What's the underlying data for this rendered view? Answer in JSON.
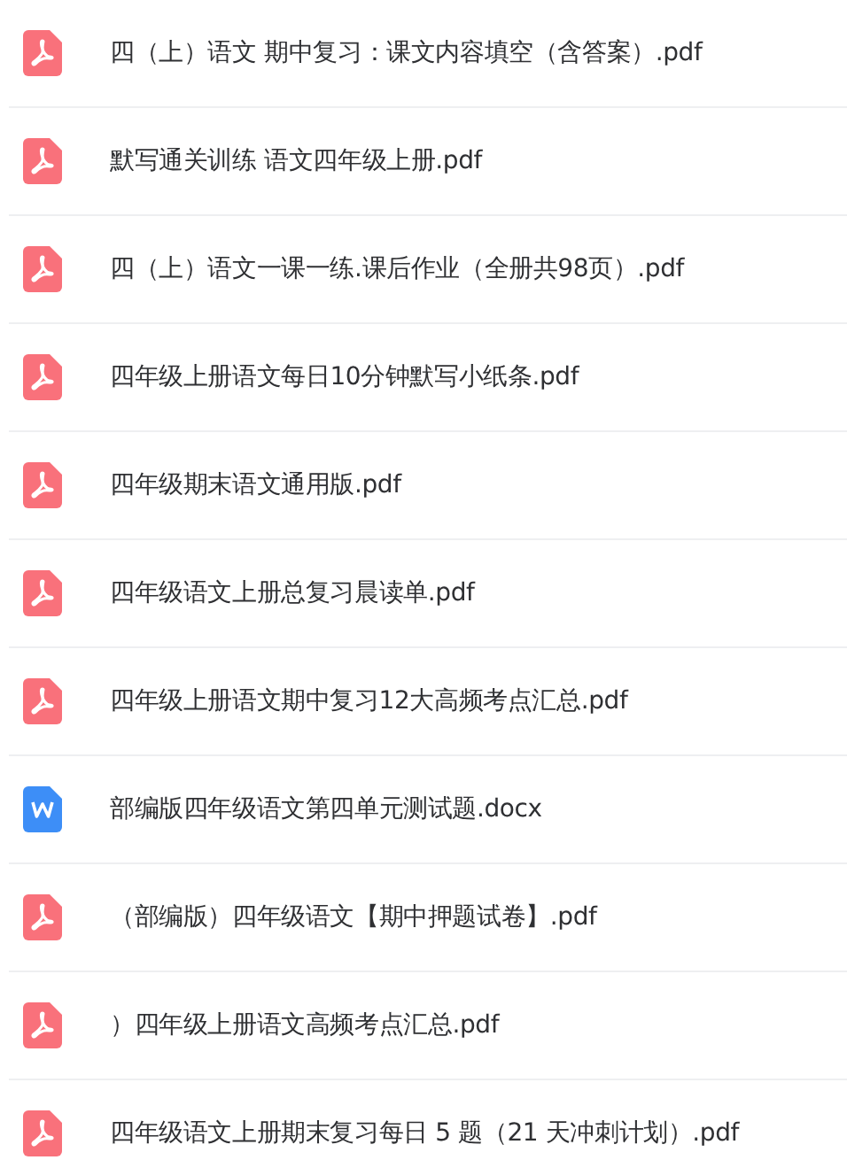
{
  "files": [
    {
      "kind": "pdf",
      "name": "四（上）语文 期中复习：课文内容填空（含答案）.pdf"
    },
    {
      "kind": "pdf",
      "name": "默写通关训练 语文四年级上册.pdf"
    },
    {
      "kind": "pdf",
      "name": "四（上）语文一课一练.课后作业（全册共98页）.pdf"
    },
    {
      "kind": "pdf",
      "name": "四年级上册语文每日10分钟默写小纸条.pdf"
    },
    {
      "kind": "pdf",
      "name": "四年级期末语文通用版.pdf"
    },
    {
      "kind": "pdf",
      "name": "四年级语文上册总复习晨读单.pdf"
    },
    {
      "kind": "pdf",
      "name": "四年级上册语文期中复习12大高频考点汇总.pdf"
    },
    {
      "kind": "docx",
      "name": "部编版四年级语文第四单元测试题.docx"
    },
    {
      "kind": "pdf",
      "name": "（部编版）四年级语文【期中押题试卷】.pdf"
    },
    {
      "kind": "pdf",
      "name": "）四年级上册语文高频考点汇总.pdf"
    },
    {
      "kind": "pdf",
      "name": "四年级语文上册期末复习每日 5 题（21 天冲刺计划）.pdf"
    }
  ]
}
